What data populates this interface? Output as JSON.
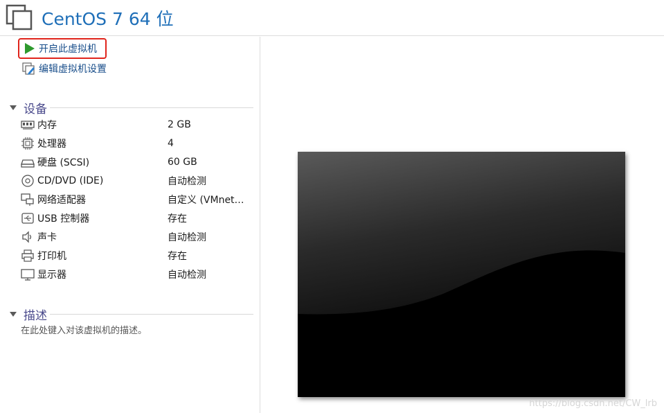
{
  "window": {
    "title": "CentOS 7 64 位"
  },
  "actions": {
    "start_label": "开启此虚拟机",
    "edit_label": "编辑虚拟机设置"
  },
  "devices": {
    "heading": "设备",
    "items": [
      {
        "name": "内存",
        "value": "2 GB",
        "icon": "memory-icon"
      },
      {
        "name": "处理器",
        "value": "4",
        "icon": "cpu-icon"
      },
      {
        "name": "硬盘 (SCSI)",
        "value": "60 GB",
        "icon": "hard-disk-icon"
      },
      {
        "name": "CD/DVD (IDE)",
        "value": "自动检测",
        "icon": "cd-dvd-icon"
      },
      {
        "name": "网络适配器",
        "value": "自定义 (VMnet…",
        "icon": "network-adapter-icon"
      },
      {
        "name": "USB 控制器",
        "value": "存在",
        "icon": "usb-icon"
      },
      {
        "name": "声卡",
        "value": "自动检测",
        "icon": "speaker-icon"
      },
      {
        "name": "打印机",
        "value": "存在",
        "icon": "printer-icon"
      },
      {
        "name": "显示器",
        "value": "自动检测",
        "icon": "monitor-icon"
      }
    ]
  },
  "description": {
    "heading": "描述",
    "placeholder": "在此处键入对该虚拟机的描述。"
  },
  "watermark": "https://blog.csdn.net/CW_lrb",
  "colors": {
    "title": "#1f6fb8",
    "link": "#1a4f8b",
    "highlight_box": "#e0241b",
    "play": "#2e9a2e"
  }
}
